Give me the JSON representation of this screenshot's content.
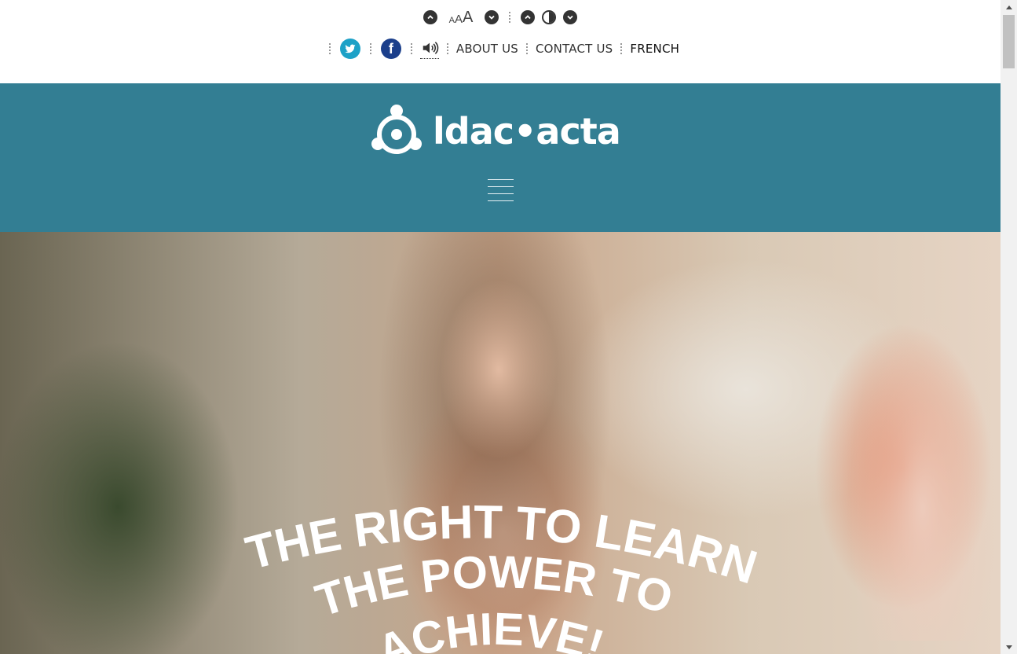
{
  "utility": {
    "font_size_glyph": [
      "A",
      "A",
      "A"
    ],
    "nav": {
      "about": "ABOUT US",
      "contact": "CONTACT US",
      "french": "FRENCH"
    },
    "icons": [
      "font-increase-icon",
      "font-size-icon",
      "font-decrease-icon",
      "contrast-increase-icon",
      "contrast-icon",
      "contrast-decrease-icon",
      "twitter-icon",
      "facebook-icon",
      "speaker-icon"
    ]
  },
  "header": {
    "logo_text": "ldac•acta",
    "background": "#337e93"
  },
  "hero": {
    "line1": "THE RIGHT TO LEARN,",
    "line2": "THE POWER TO",
    "line3": "ACHIEVE!"
  }
}
